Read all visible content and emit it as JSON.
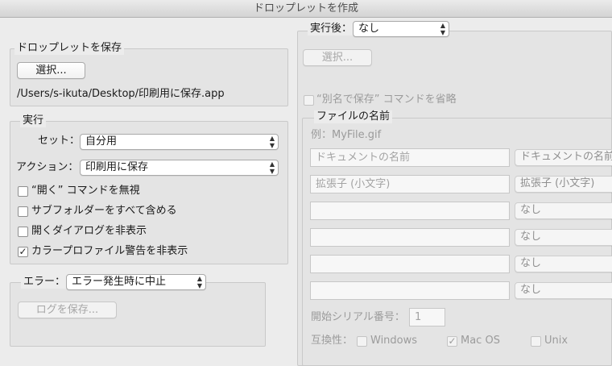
{
  "window": {
    "title": "ドロップレットを作成"
  },
  "save_droplet": {
    "legend": "ドロップレットを保存",
    "choose_label": "選択...",
    "path": "/Users/s-ikuta/Desktop/印刷用に保存.app"
  },
  "play": {
    "legend": "実行",
    "set_label": "セット：",
    "set_value": "自分用",
    "action_label": "アクション：",
    "action_value": "印刷用に保存",
    "options": [
      {
        "label": "“開く” コマンドを無視",
        "checked": false
      },
      {
        "label": "サブフォルダーをすべて含める",
        "checked": false
      },
      {
        "label": "開くダイアログを非表示",
        "checked": false
      },
      {
        "label": "カラープロファイル警告を非表示",
        "checked": true
      }
    ]
  },
  "errors": {
    "label": "エラー：",
    "value": "エラー発生時に中止",
    "save_log_label": "ログを保存..."
  },
  "destination": {
    "label": "実行後：",
    "value": "なし",
    "choose_label": "選択...",
    "override_save_as": "“別名で保存” コマンドを省略"
  },
  "file_naming": {
    "legend": "ファイルの名前",
    "example": "例：MyFile.gif",
    "rows": [
      {
        "field": "ドキュメントの名前",
        "select": "ドキュメントの名前"
      },
      {
        "field": "拡張子 (小文字)",
        "select": "拡張子 (小文字)"
      },
      {
        "field": "",
        "select": "なし"
      },
      {
        "field": "",
        "select": "なし"
      },
      {
        "field": "",
        "select": "なし"
      },
      {
        "field": "",
        "select": "なし"
      }
    ],
    "serial_label": "開始シリアル番号：",
    "serial_value": "1",
    "compat_label": "互換性：",
    "compat": [
      {
        "label": "Windows",
        "checked": false
      },
      {
        "label": "Mac OS",
        "checked": true
      },
      {
        "label": "Unix",
        "checked": false
      }
    ]
  },
  "icons": {
    "checkmark": "✓",
    "select_arrows": "chevron-up-down-icon"
  }
}
